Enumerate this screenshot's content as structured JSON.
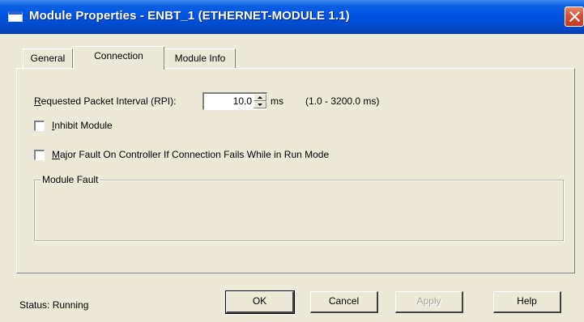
{
  "window": {
    "title": "Module Properties - ENBT_1 (ETHERNET-MODULE 1.1)",
    "titlebar_color": "#0054e3",
    "close_color": "#d9533a"
  },
  "tabs": [
    {
      "label": "General",
      "active": false
    },
    {
      "label": "Connection",
      "active": true
    },
    {
      "label": "Module Info",
      "active": false
    }
  ],
  "connection": {
    "rpi": {
      "label_accel": "R",
      "label_rest": "equested Packet Interval (RPI):",
      "value": "10.0",
      "unit": "ms",
      "range": "(1.0 - 3200.0 ms)"
    },
    "inhibit": {
      "label_accel": "I",
      "label_rest": "nhibit Module",
      "checked": false
    },
    "major_fault": {
      "label_accel": "M",
      "label_rest": "ajor Fault On Controller If Connection Fails While in Run Mode",
      "checked": false
    },
    "module_fault": {
      "label": "Module Fault"
    }
  },
  "footer": {
    "status": "Status:  Running",
    "ok": "OK",
    "cancel": "Cancel",
    "apply": "Apply",
    "help": "Help"
  }
}
